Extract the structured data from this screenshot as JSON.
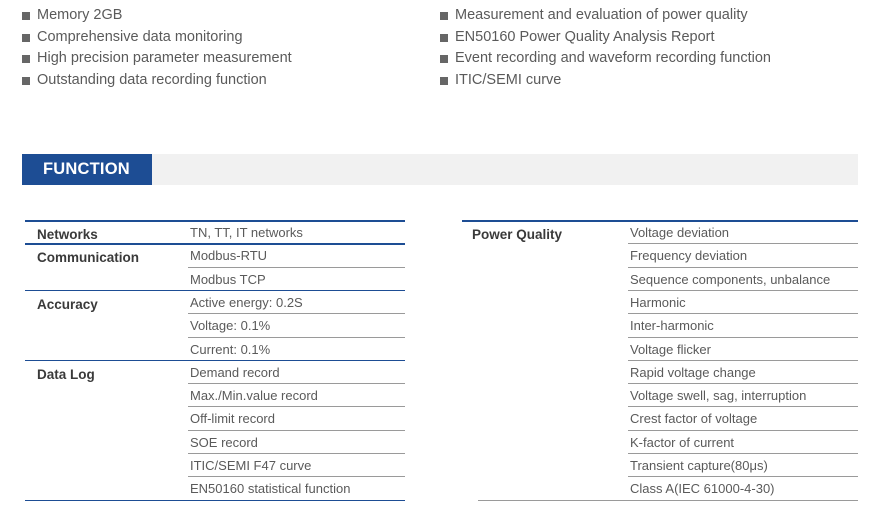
{
  "features": {
    "left": [
      "Memory 2GB",
      "Comprehensive data monitoring",
      "High precision parameter measurement",
      "Outstanding data recording function"
    ],
    "right": [
      "Measurement and evaluation of power quality",
      "EN50160 Power Quality Analysis Report",
      "Event recording and waveform recording function",
      "ITIC/SEMI curve"
    ]
  },
  "section": {
    "title": "FUNCTION"
  },
  "spec_left": [
    {
      "label": "Networks",
      "values": [
        "TN, TT, IT networks"
      ]
    },
    {
      "label": "Communication",
      "values": [
        "Modbus-RTU",
        "Modbus TCP"
      ]
    },
    {
      "label": "Accuracy",
      "values": [
        "Active energy: 0.2S",
        "Voltage: 0.1%",
        "Current: 0.1%"
      ]
    },
    {
      "label": "Data Log",
      "values": [
        "Demand record",
        "Max./Min.value record",
        "Off-limit record",
        "SOE record",
        "ITIC/SEMI F47 curve",
        "EN50160 statistical function"
      ]
    }
  ],
  "spec_right": [
    {
      "label": "Power Quality",
      "values": [
        "Voltage deviation",
        "Frequency deviation",
        "Sequence components, unbalance",
        "Harmonic",
        "Inter-harmonic",
        "Voltage flicker",
        "Rapid voltage change",
        "Voltage swell, sag, interruption",
        "Crest factor of voltage",
        "K-factor of current",
        "Transient capture(80μs)",
        "Class A(IEC 61000-4-30)"
      ]
    }
  ]
}
